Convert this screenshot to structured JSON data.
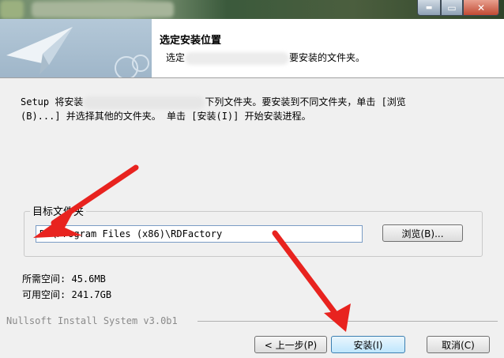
{
  "header": {
    "title": "选定安装位置",
    "subtitle_pre": "选定",
    "subtitle_post": "要安装的文件夹。"
  },
  "description": {
    "line1_pre": "Setup 将安装",
    "line1_post": "下列文件夹。要安装到不同文件夹，单击 [浏览",
    "line2": "(B)...] 并选择其他的文件夹。 单击 [安装(I)] 开始安装进程。"
  },
  "target": {
    "group_label": "目标文件夹",
    "path": "D:\\Program Files (x86)\\RDFactory",
    "browse_label": "浏览(B)..."
  },
  "space": {
    "required_label": "所需空间:",
    "required_value": "45.6MB",
    "available_label": "可用空间:",
    "available_value": "241.7GB"
  },
  "footer": {
    "brand": "Nullsoft Install System v3.0b1",
    "back_label": "< 上一步(P)",
    "install_label": "安装(I)",
    "cancel_label": "取消(C)"
  },
  "window": {
    "min_glyph": "▬",
    "max_glyph": "▭",
    "close_glyph": "✕"
  },
  "colors": {
    "annotation_arrow": "#e8231f",
    "header_bg": "#ffffff",
    "dialog_bg": "#f0f0f0"
  }
}
